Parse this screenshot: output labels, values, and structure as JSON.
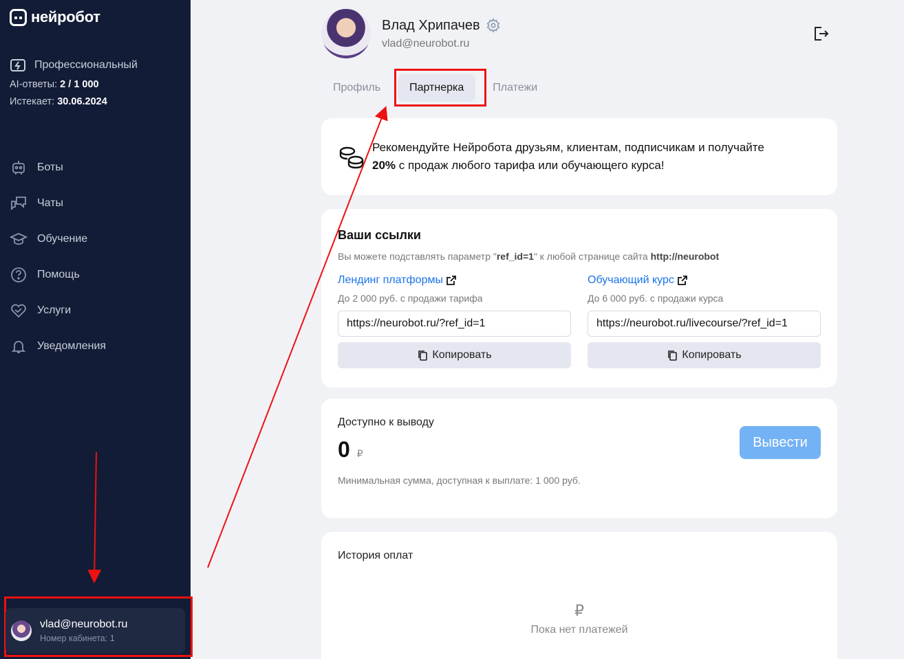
{
  "app": {
    "logo_text": "нейробот"
  },
  "plan": {
    "name": "Профессиональный",
    "ai_label": "AI-ответы:",
    "ai_value": "2 / 1 000",
    "expires_label": "Истекает:",
    "expires_value": "30.06.2024"
  },
  "sidebar": {
    "items": [
      {
        "label": "Боты",
        "icon": "robot-icon"
      },
      {
        "label": "Чаты",
        "icon": "chat-icon"
      },
      {
        "label": "Обучение",
        "icon": "graduation-cap-icon"
      },
      {
        "label": "Помощь",
        "icon": "help-circle-icon"
      },
      {
        "label": "Услуги",
        "icon": "handshake-heart-icon"
      },
      {
        "label": "Уведомления",
        "icon": "bell-icon"
      }
    ]
  },
  "account": {
    "email": "vlad@neurobot.ru",
    "number": "Номер кабинета: 1"
  },
  "user": {
    "name": "Влад Хрипачев",
    "email": "vlad@neurobot.ru"
  },
  "tabs": [
    {
      "label": "Профиль",
      "active": false
    },
    {
      "label": "Партнерка",
      "active": true
    },
    {
      "label": "Платежи",
      "active": false
    }
  ],
  "promo": {
    "text_1": "Рекомендуйте Нейробота друзьям, клиентам, подписчикам и получайте",
    "bold": "20%",
    "text_2": " с продаж любого тарифа или обучающего курса!"
  },
  "links": {
    "title": "Ваши ссылки",
    "sub_1": "Вы можете подставлять параметр \"",
    "sub_param": "ref_id=1",
    "sub_2": "\" к любой странице сайта ",
    "sub_site": "http://neurobot",
    "items": [
      {
        "title": "Лендинг платформы",
        "note": "До 2 000 руб. с продажи тарифа",
        "url": "https://neurobot.ru/?ref_id=1",
        "copy": "Копировать"
      },
      {
        "title": "Обучающий курс",
        "note": "До 6 000 руб. с продажи курса",
        "url": "https://neurobot.ru/livecourse/?ref_id=1",
        "copy": "Копировать"
      }
    ]
  },
  "withdraw": {
    "title": "Доступно к выводу",
    "amount": "0",
    "currency": "₽",
    "min_note": "Минимальная сумма, доступная к выплате: 1 000 руб.",
    "button": "Вывести",
    "button_color": "#73b2f5"
  },
  "history": {
    "title": "История оплат",
    "icon": "₽",
    "empty": "Пока нет платежей"
  },
  "annotations": {
    "color": "#e11111"
  }
}
